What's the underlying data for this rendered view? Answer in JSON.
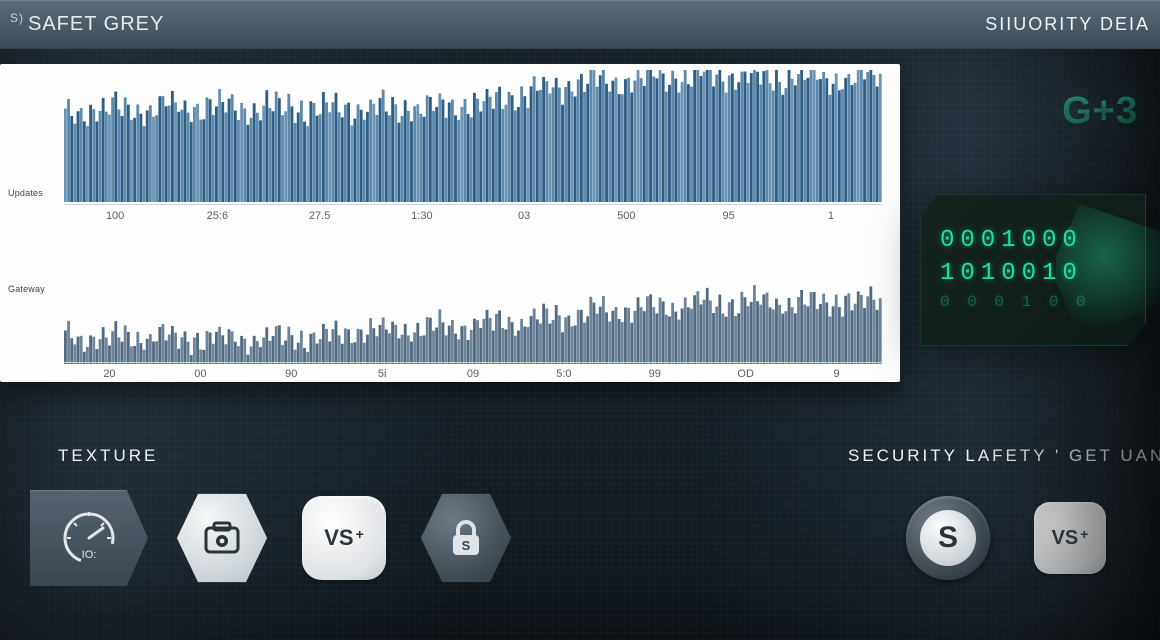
{
  "header": {
    "left_badge_sup": "S)",
    "left_badge_main": "SAFET GREY",
    "right_label": "SIIUORITY DEIA"
  },
  "brand_mark": "G+3",
  "binary_panel": {
    "rows": [
      "0001000",
      "1010010",
      "0 0 0 1 0 0"
    ]
  },
  "sections": {
    "left_title": "TEXTURE",
    "right_title": "SECURITY LAFETY ' GET UANA"
  },
  "tiles": {
    "gauge_label": "IO:",
    "vs_label_1": "VS",
    "vs_label_2": "VS",
    "lock_letter": "S",
    "disc_letter": "S"
  },
  "chart_data": [
    {
      "type": "bar",
      "name": "top-density-strip",
      "ylabel": "Updates",
      "ylim": [
        0,
        100
      ],
      "x_ticks": [
        "100",
        "25:6",
        "27.5",
        "1:30",
        "03",
        "500",
        "95",
        "1"
      ],
      "note": "Dense high-frequency strip; approximate envelope heights as percentages across the 8 tick segments.",
      "segments": [
        {
          "tick": "100",
          "approx_h": 68
        },
        {
          "tick": "25:6",
          "approx_h": 72
        },
        {
          "tick": "27.5",
          "approx_h": 72
        },
        {
          "tick": "1:30",
          "approx_h": 70
        },
        {
          "tick": "03",
          "approx_h": 74
        },
        {
          "tick": "500",
          "approx_h": 90
        },
        {
          "tick": "95",
          "approx_h": 96
        },
        {
          "tick": "1",
          "approx_h": 94
        }
      ]
    },
    {
      "type": "bar",
      "name": "bottom-density-strip",
      "ylabel": "Gateway",
      "ylim": [
        0,
        100
      ],
      "x_ticks": [
        "20",
        "00",
        "90",
        "5i",
        "09",
        "5:0",
        "99",
        "OD",
        "9"
      ],
      "note": "Shorter strip with rising envelope; approximate heights as percentages across the 9 tick segments.",
      "segments": [
        {
          "tick": "20",
          "approx_h": 22
        },
        {
          "tick": "00",
          "approx_h": 22
        },
        {
          "tick": "90",
          "approx_h": 21
        },
        {
          "tick": "5i",
          "approx_h": 25
        },
        {
          "tick": "09",
          "approx_h": 30
        },
        {
          "tick": "5:0",
          "approx_h": 36
        },
        {
          "tick": "99",
          "approx_h": 44
        },
        {
          "tick": "OD",
          "approx_h": 50
        },
        {
          "tick": "9",
          "approx_h": 52
        }
      ]
    }
  ]
}
